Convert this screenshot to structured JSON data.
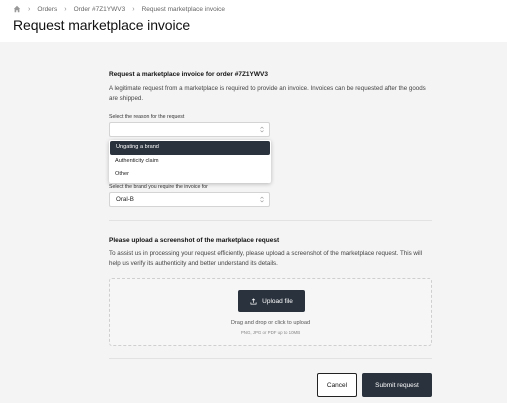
{
  "breadcrumb": {
    "home_icon": "home-icon",
    "items": [
      "Orders",
      "Order #7Z1YWV3",
      "Request marketplace invoice"
    ]
  },
  "page_title": "Request marketplace invoice",
  "request_section": {
    "title": "Request a marketplace invoice for order #7Z1YWV3",
    "description": "A legitimate request from a marketplace is required to provide an invoice. Invoices can be requested after the goods are shipped.",
    "reason_label": "Select the reason for the request",
    "reason_value": "",
    "reason_options": [
      "Ungating a brand",
      "Authenticity claim",
      "Other"
    ],
    "brand_label": "Select the brand you require the invoice for",
    "brand_value": "Oral-B"
  },
  "upload_section": {
    "title": "Please upload a screenshot of the marketplace request",
    "description": "To assist us in processing your request efficiently, please upload a screenshot of the marketplace request. This will help us verify its authenticity and better understand its details.",
    "upload_button": "Upload file",
    "drop_text": "Drag and drop or click to upload",
    "drop_subtext": "PNG, JPG or PDF up to 10MB"
  },
  "actions": {
    "cancel": "Cancel",
    "submit": "Submit request"
  },
  "colors": {
    "primary": "#2a323d",
    "background": "#f4f4f4"
  }
}
